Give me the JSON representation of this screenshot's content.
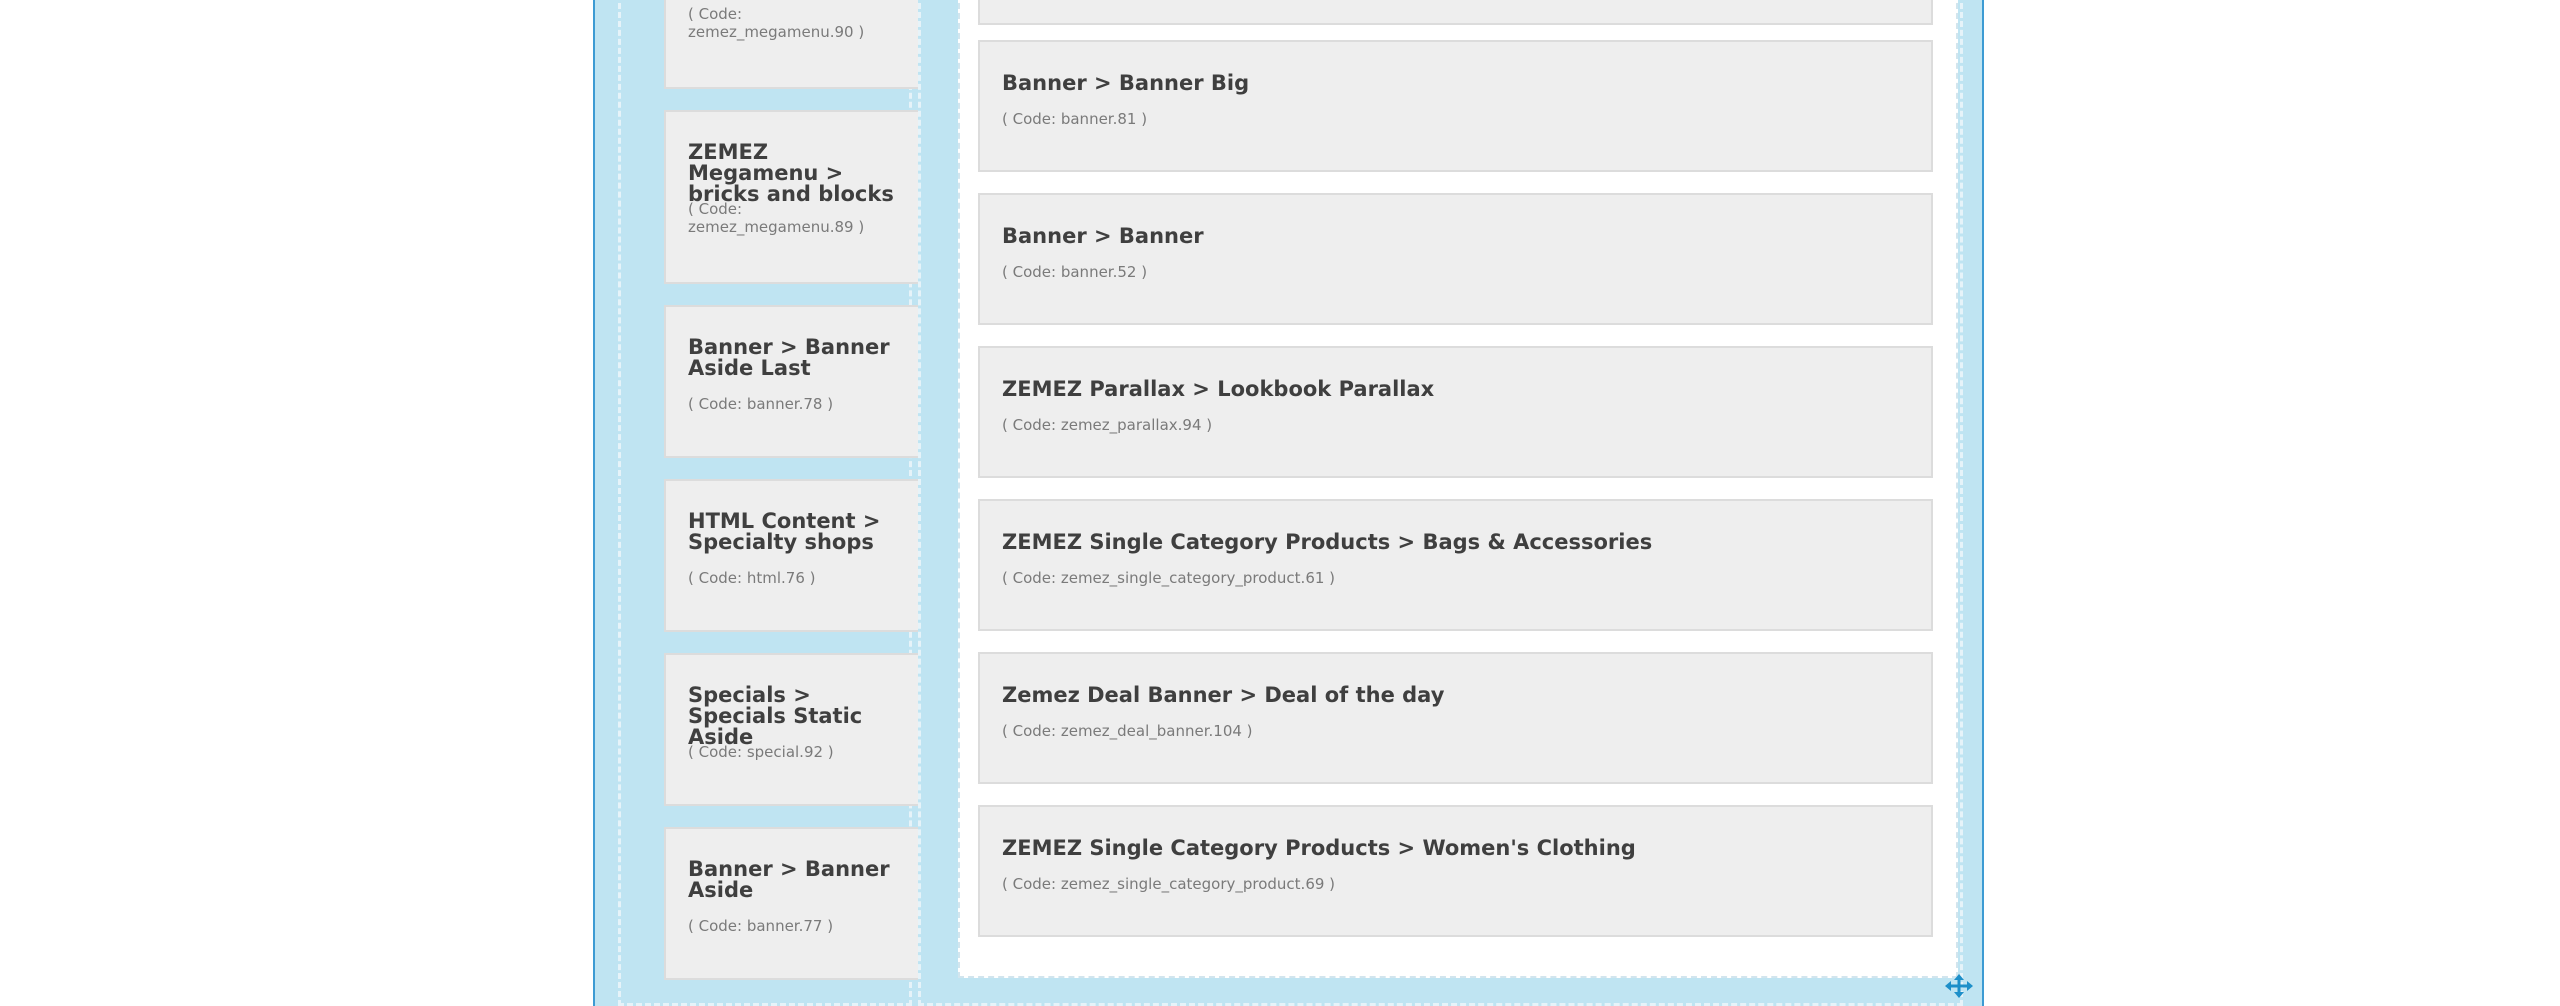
{
  "left_modules": [
    {
      "title": "",
      "code": "( Code: zemez_megamenu.90 )"
    },
    {
      "title": "ZEMEZ Megamenu > bricks and blocks",
      "code": "( Code: zemez_megamenu.89 )"
    },
    {
      "title": "Banner > Banner Aside Last",
      "code": "( Code: banner.78 )"
    },
    {
      "title": "HTML Content > Specialty shops",
      "code": "( Code: html.76 )"
    },
    {
      "title": "Specials > Specials Static Aside",
      "code": "( Code: special.92 )"
    },
    {
      "title": "Banner > Banner Aside",
      "code": "( Code: banner.77 )"
    }
  ],
  "right_modules": [
    {
      "title": "",
      "code": ""
    },
    {
      "title": "Banner > Banner Big",
      "code": "( Code: banner.81 )"
    },
    {
      "title": "Banner > Banner",
      "code": "( Code: banner.52 )"
    },
    {
      "title": "ZEMEZ Parallax > Lookbook Parallax",
      "code": "( Code: zemez_parallax.94 )"
    },
    {
      "title": "ZEMEZ Single Category Products > Bags & Accessories",
      "code": "( Code: zemez_single_category_product.61 )"
    },
    {
      "title": "Zemez Deal Banner > Deal of the day",
      "code": "( Code: zemez_deal_banner.104 )"
    },
    {
      "title": "ZEMEZ Single Category Products > Women's Clothing",
      "code": "( Code: zemez_single_category_product.69 )"
    }
  ],
  "icons": {
    "move_handle": "move-arrows-icon"
  },
  "colors": {
    "layout_bg": "#bfe4f2",
    "layout_border": "#3d9bd3",
    "module_bg": "#eeeeee",
    "icon_accent": "#1d8fc9"
  }
}
